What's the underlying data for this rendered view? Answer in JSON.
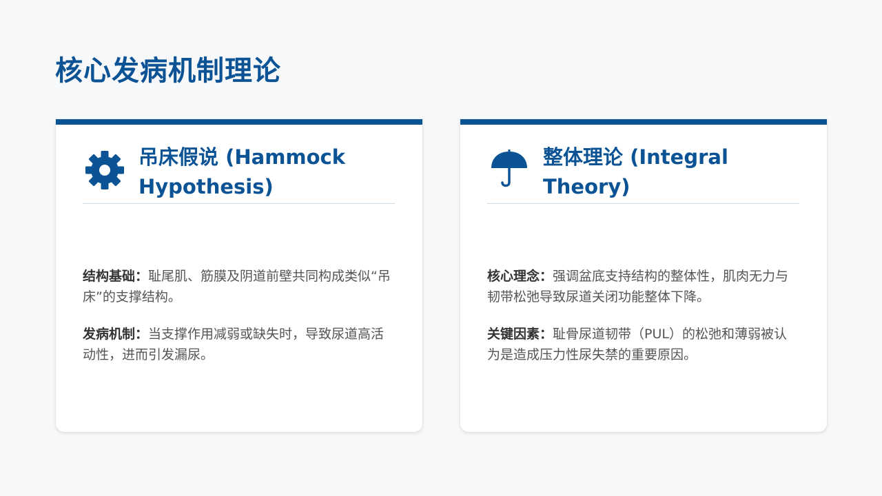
{
  "page": {
    "title": "核心发病机制理论"
  },
  "cards": [
    {
      "title": "吊床假说 (Hammock Hypothesis)",
      "icon": "gear-icon",
      "paragraphs": [
        {
          "label": "结构基础：",
          "text": "耻尾肌、筋膜及阴道前壁共同构成类似“吊床”的支撑结构。"
        },
        {
          "label": "发病机制：",
          "text": "当支撑作用减弱或缺失时，导致尿道高活动性，进而引发漏尿。"
        }
      ]
    },
    {
      "title": "整体理论 (Integral Theory)",
      "icon": "umbrella-icon",
      "paragraphs": [
        {
          "label": "核心理念：",
          "text": "强调盆底支持结构的整体性，肌肉无力与韧带松弛导致尿道关闭功能整体下降。"
        },
        {
          "label": "关键因素：",
          "text": "耻骨尿道韧带（PUL）的松弛和薄弱被认为是造成压力性尿失禁的重要原因。"
        }
      ]
    }
  ],
  "colors": {
    "accent": "#0b5394",
    "background": "#f7f8fa",
    "card": "#ffffff",
    "divider": "#cfdbe6",
    "label_text": "#333333",
    "body_text": "#555555"
  }
}
